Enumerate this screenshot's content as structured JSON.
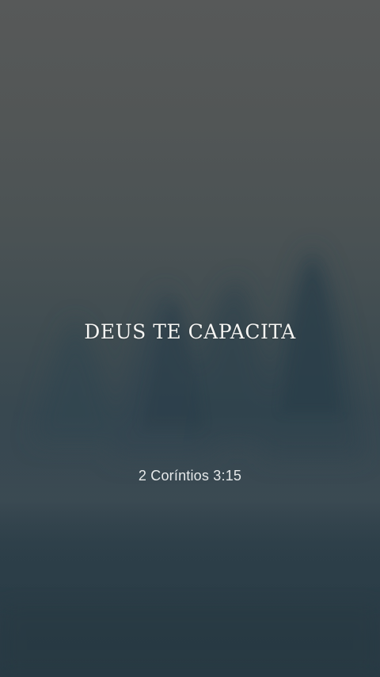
{
  "verse": {
    "title": "DEUS TE CAPACITA",
    "reference": "2 Coríntios 3:15"
  },
  "colors": {
    "sky_top": "#575959",
    "fog_mid": "#3f4c51",
    "ground_bottom": "#283a44",
    "text": "#f4f4f2"
  }
}
